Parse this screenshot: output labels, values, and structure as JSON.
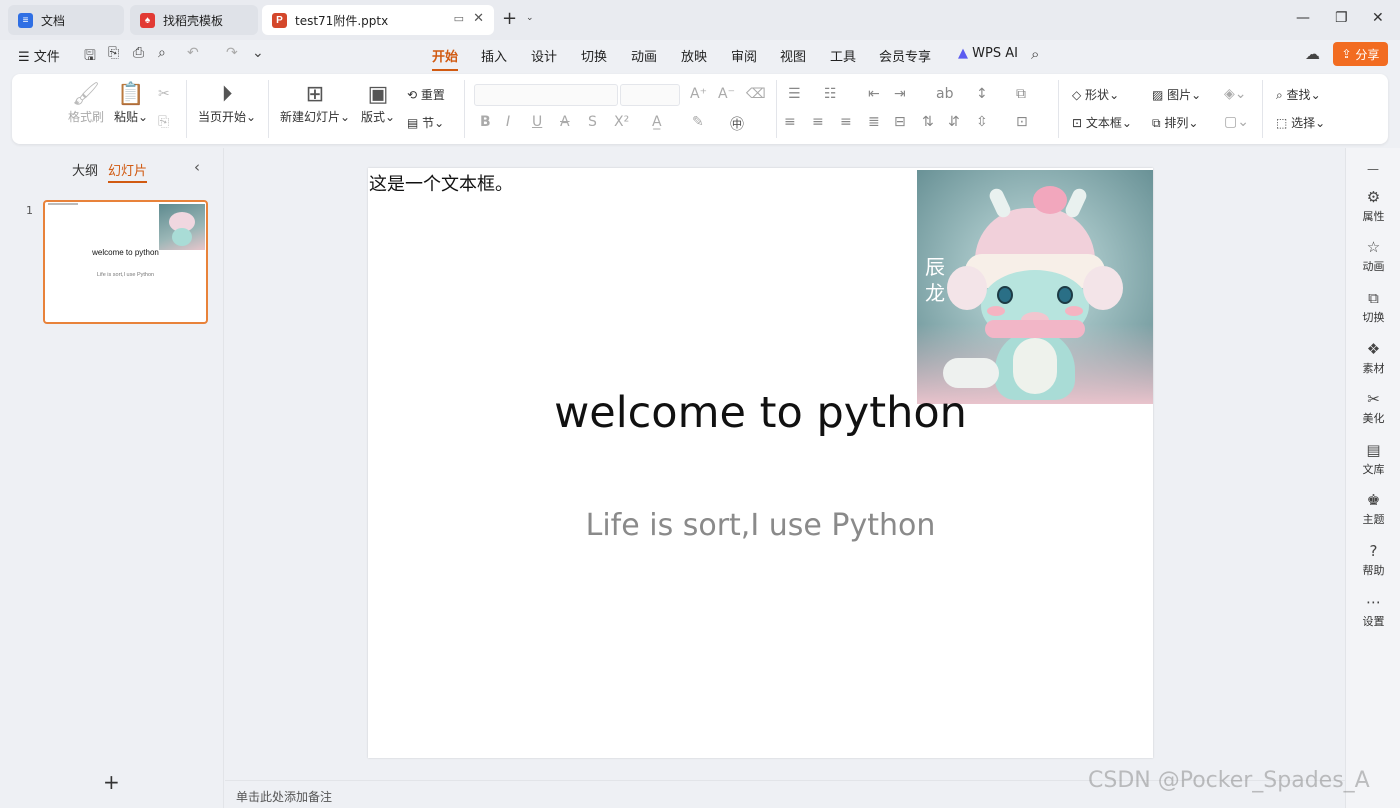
{
  "tabs": [
    {
      "label": "文档",
      "icon": "docs-icon",
      "color": "#2f6fe4"
    },
    {
      "label": "找稻壳模板",
      "icon": "docer-icon",
      "color": "#e23a34"
    },
    {
      "label": "test71附件.pptx",
      "icon": "pptx-icon",
      "color": "#d4472b",
      "letter": "P"
    }
  ],
  "menu": {
    "file": "文件",
    "items": [
      "开始",
      "插入",
      "设计",
      "切换",
      "动画",
      "放映",
      "审阅",
      "视图",
      "工具",
      "会员专享"
    ],
    "active": "开始",
    "wps_ai": "WPS AI",
    "share": "分享"
  },
  "ribbon": {
    "format_painter": "格式刷",
    "paste": "粘贴",
    "from_current": "当页开始",
    "new_slide": "新建幻灯片",
    "layout": "版式",
    "reset": "重置",
    "section": "节",
    "shape": "形状",
    "picture": "图片",
    "textbox": "文本框",
    "arrange": "排列",
    "find": "查找",
    "select": "选择"
  },
  "left_panel": {
    "outline_tab": "大纲",
    "slides_tab": "幻灯片",
    "slide_number": "1",
    "thumb_title": "welcome to python",
    "thumb_subtitle": "Life is sort,I use Python",
    "add_button": "+"
  },
  "slide": {
    "textbox": "这是一个文本框。",
    "title": "welcome to python",
    "subtitle": "Life is sort,I use Python",
    "image_caption": "辰龙"
  },
  "right_bar": [
    {
      "label": "属性",
      "icon": "properties-icon",
      "glyph": "⚙"
    },
    {
      "label": "动画",
      "icon": "animation-icon",
      "glyph": "☆"
    },
    {
      "label": "切换",
      "icon": "transition-icon",
      "glyph": "⧉"
    },
    {
      "label": "素材",
      "icon": "material-icon",
      "glyph": "❖"
    },
    {
      "label": "美化",
      "icon": "beautify-icon",
      "glyph": "✂"
    },
    {
      "label": "文库",
      "icon": "library-icon",
      "glyph": "▤"
    },
    {
      "label": "主题",
      "icon": "theme-icon",
      "glyph": "♚"
    },
    {
      "label": "帮助",
      "icon": "help-icon",
      "glyph": "?"
    },
    {
      "label": "设置",
      "icon": "settings-icon",
      "glyph": "⋯"
    }
  ],
  "notes_placeholder": "单击此处添加备注",
  "watermark": "CSDN @Pocker_Spades_A"
}
